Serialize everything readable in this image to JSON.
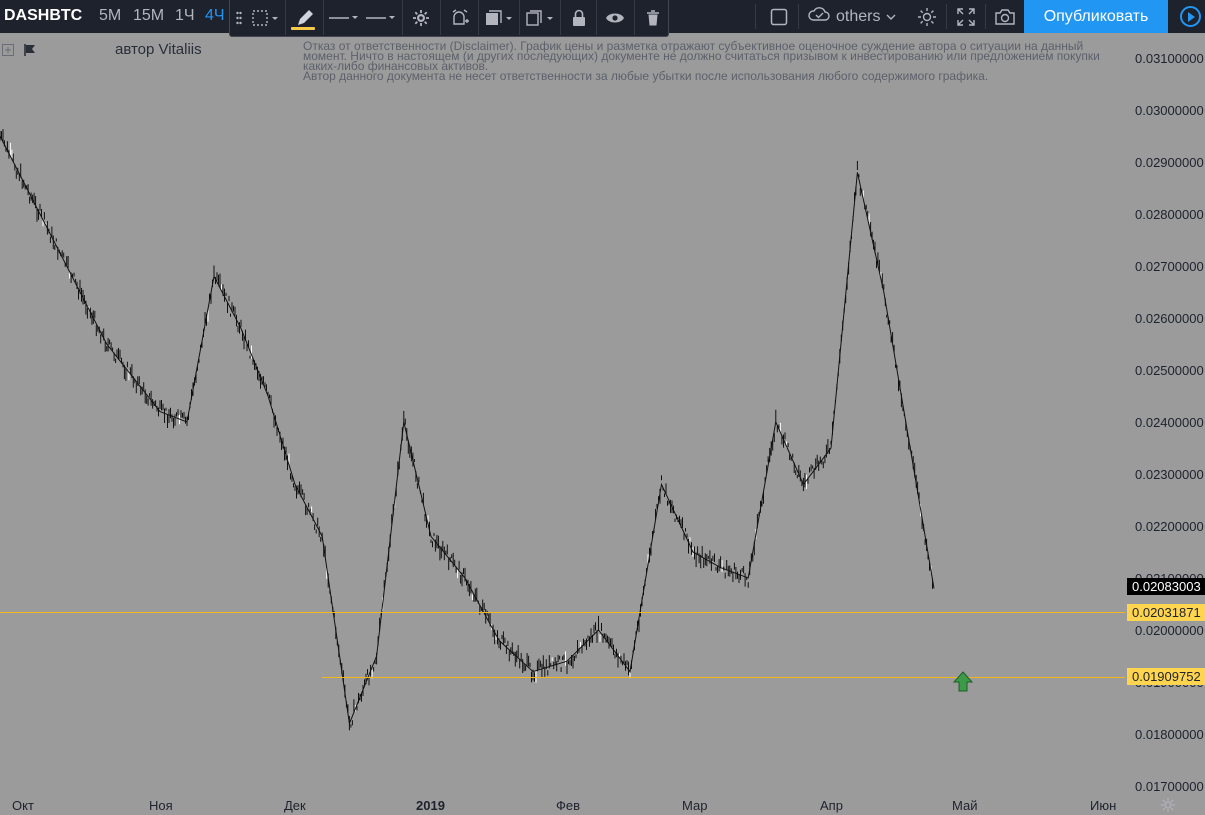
{
  "toolbar": {
    "symbol": "DASHBTC",
    "timeframes": [
      {
        "label": "5М",
        "active": false
      },
      {
        "label": "15М",
        "active": false
      },
      {
        "label": "1Ч",
        "active": false
      },
      {
        "label": "4Ч",
        "active": true
      }
    ],
    "others_label": "others",
    "publish_label": "Опубликовать"
  },
  "drawing_toolbar": {
    "tools": [
      "select-area-icon",
      "pencil-icon",
      "line-style-icon",
      "line-width-icon",
      "settings-icon",
      "alert-icon",
      "layers-icon",
      "clone-icon",
      "lock-icon",
      "visibility-icon",
      "trash-icon"
    ],
    "accent_color": "#f7c948"
  },
  "chart": {
    "author": "автор Vitaliis",
    "disclaimer": [
      "Отказ от ответственности (Disclaimer). График цены и разметка отражают субъективное оценочное суждение автора о ситуации на данный",
      "момент. Ничто в настоящем (и других последующих) документе не должно считаться призывом к инвестированию или предложением покупки",
      "каких-либо финансовых активов.",
      "Автор данного документа не несет ответственности за любые убытки после использования любого содержимого графика."
    ],
    "background": "#9b9b9b",
    "line_color": "#f5b81c"
  },
  "price_axis": [
    "0.03100000",
    "0.03000000",
    "0.02900000",
    "0.02800000",
    "0.02700000",
    "0.02600000",
    "0.02500000",
    "0.02400000",
    "0.02300000",
    "0.02200000",
    "0.02100000",
    "0.02000000",
    "0.01900000",
    "0.01800000",
    "0.01700000"
  ],
  "price_tags": {
    "last_price": "0.02083003",
    "level_1": "0.02031871",
    "level_2": "0.01909752"
  },
  "time_axis": [
    {
      "label": "Окт",
      "bold": false
    },
    {
      "label": "Ноя",
      "bold": false
    },
    {
      "label": "Дек",
      "bold": false
    },
    {
      "label": "2019",
      "bold": true
    },
    {
      "label": "Фев",
      "bold": false
    },
    {
      "label": "Мар",
      "bold": false
    },
    {
      "label": "Апр",
      "bold": false
    },
    {
      "label": "Май",
      "bold": false
    },
    {
      "label": "Июн",
      "bold": false
    }
  ],
  "chart_data": {
    "type": "line",
    "symbol": "DASHBTC",
    "ylim": [
      0.017,
      0.031
    ],
    "x_ticks": [
      "Окт",
      "Ноя",
      "Дек",
      "2019",
      "Фев",
      "Мар",
      "Апр",
      "Май",
      "Июн"
    ],
    "series": [
      {
        "x": [
          "Окт",
          "Окт",
          "Окт",
          "Ноя",
          "Ноя",
          "Ноя",
          "Ноя",
          "Ноя",
          "Дек",
          "Дек",
          "Дек",
          "Дек",
          "Дек",
          "2019",
          "2019",
          "2019",
          "2019",
          "Фев",
          "Фев",
          "Фев",
          "Фев",
          "Мар",
          "Мар",
          "Мар",
          "Мар",
          "Мар",
          "Апр",
          "Апр",
          "Апр",
          "Апр",
          "Апр"
        ],
        "values": [
          0.0295,
          0.0275,
          0.0255,
          0.0242,
          0.024,
          0.0268,
          0.0258,
          0.0245,
          0.0228,
          0.0218,
          0.0182,
          0.0195,
          0.024,
          0.0218,
          0.021,
          0.0198,
          0.0192,
          0.0194,
          0.02,
          0.0192,
          0.0228,
          0.0215,
          0.0212,
          0.021,
          0.024,
          0.0228,
          0.0235,
          0.0288,
          0.0265,
          0.0235,
          0.0208
        ]
      }
    ],
    "horizontal_lines": [
      0.02031871,
      0.01909752
    ],
    "last_price": 0.02083003
  }
}
